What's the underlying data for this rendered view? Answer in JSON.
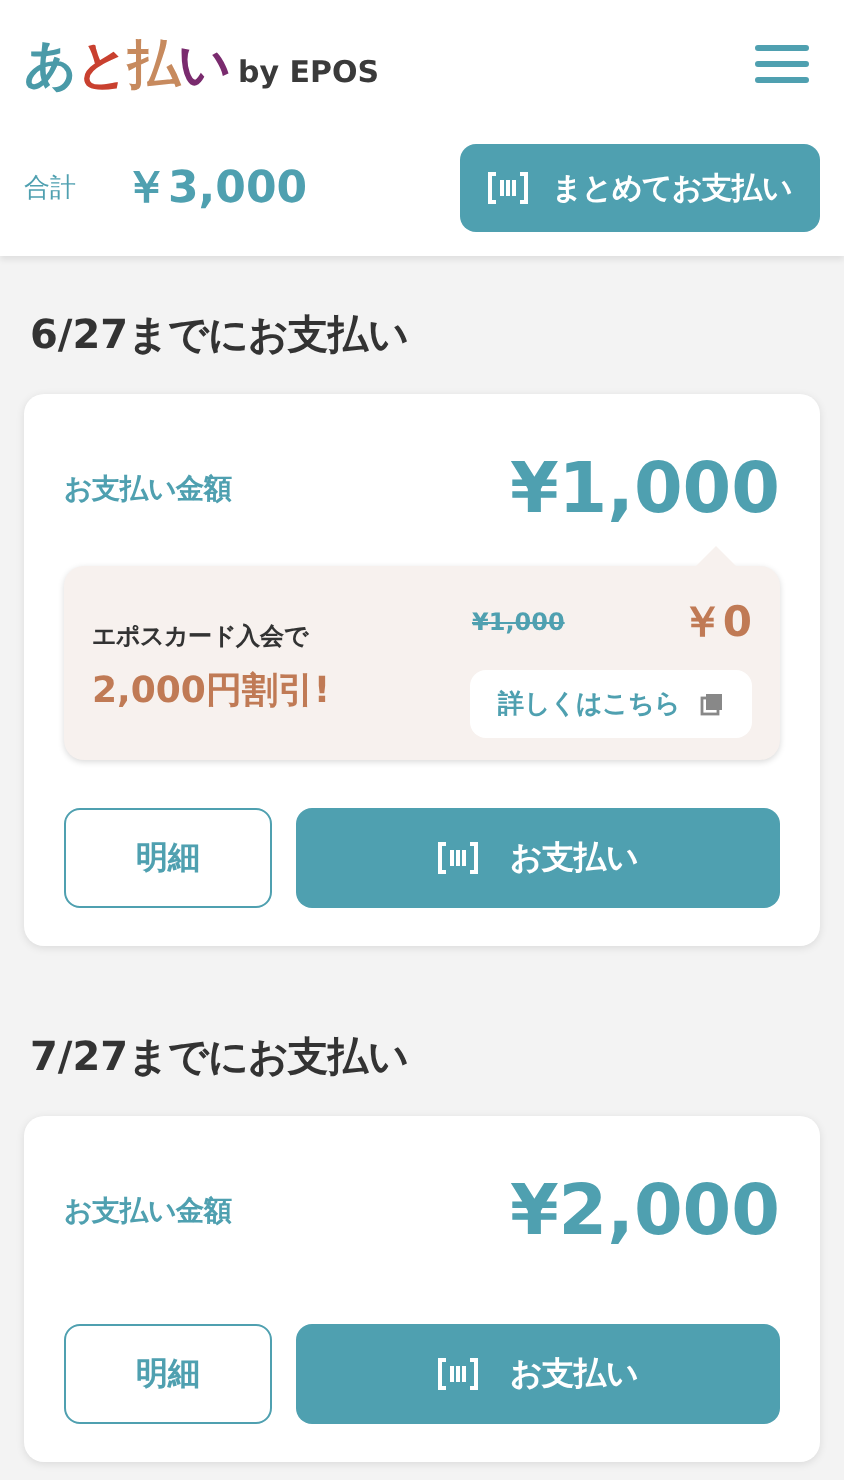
{
  "header": {
    "logo": {
      "letters": [
        {
          "text": "あ",
          "color": "#4a9aa8"
        },
        {
          "text": "と",
          "color": "#c9402f"
        },
        {
          "text": "払",
          "color": "#c78a5e"
        },
        {
          "text": "い",
          "color": "#7a2b6e"
        }
      ],
      "suffix": "by EPOS"
    },
    "total_label": "合計",
    "total": "￥3,000",
    "pay_all_button": "まとめてお支払い"
  },
  "payments": [
    {
      "due_title": "6/27までにお支払い",
      "amount_label": "お支払い金額",
      "amount": "¥1,000",
      "promo": {
        "text": "エポスカード入会で",
        "highlight": "2,000円割引!",
        "original_price": "¥1,000",
        "discounted_price": "￥0",
        "link": "詳しくはこちら"
      },
      "detail_button": "明細",
      "pay_button": "お支払い"
    },
    {
      "due_title": "7/27までにお支払い",
      "amount_label": "お支払い金額",
      "amount": "¥2,000",
      "detail_button": "明細",
      "pay_button": "お支払い"
    }
  ]
}
